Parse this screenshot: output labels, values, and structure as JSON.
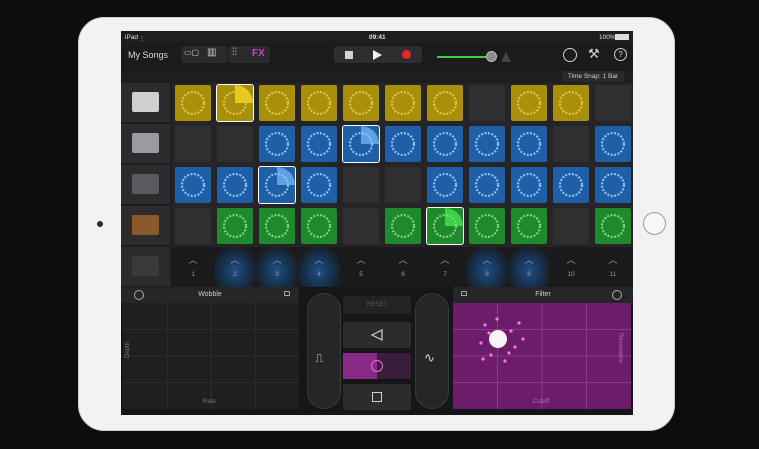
{
  "status": {
    "device": "iPad",
    "time": "09:41",
    "battery": "100%"
  },
  "toolbar": {
    "songs_label": "My Songs",
    "fx_label": "FX"
  },
  "time_snap": "Time Snap: 1 Bar",
  "instruments": [
    {
      "name": "drum-machine",
      "color": "#cfcfcf"
    },
    {
      "name": "turntable",
      "color": "#9a9aa0"
    },
    {
      "name": "synth-keyboard",
      "color": "#5a5a5e"
    },
    {
      "name": "synth-keyboard-wood",
      "color": "#8b5a2b"
    },
    {
      "name": "pencil-graph",
      "color": "#3a3a3c"
    }
  ],
  "grid": [
    [
      "yellow",
      "yellow-active",
      "yellow",
      "yellow",
      "yellow",
      "yellow",
      "yellow",
      "empty",
      "yellow",
      "yellow",
      "empty"
    ],
    [
      "empty",
      "empty",
      "blue",
      "blue",
      "blue-active",
      "blue",
      "blue",
      "blue",
      "blue",
      "empty",
      "blue"
    ],
    [
      "blue",
      "blue",
      "blue-active",
      "blue",
      "empty",
      "empty",
      "blue",
      "blue",
      "blue",
      "blue",
      "blue"
    ],
    [
      "empty",
      "green",
      "green",
      "green",
      "empty",
      "green",
      "green-active",
      "green",
      "green",
      "empty",
      "green"
    ]
  ],
  "triggers": [
    {
      "label": "1",
      "lit": false
    },
    {
      "label": "2",
      "lit": true
    },
    {
      "label": "3",
      "lit": true
    },
    {
      "label": "4",
      "lit": true
    },
    {
      "label": "5",
      "lit": false
    },
    {
      "label": "6",
      "lit": false
    },
    {
      "label": "7",
      "lit": false
    },
    {
      "label": "8",
      "lit": true
    },
    {
      "label": "9",
      "lit": true
    },
    {
      "label": "10",
      "lit": false
    },
    {
      "label": "11",
      "lit": false
    }
  ],
  "fx": {
    "left": {
      "title": "Wobble",
      "x_label": "Rate",
      "y_label": "Depth"
    },
    "right": {
      "title": "Filter",
      "x_label": "Cutoff",
      "y_label": "Resonance"
    },
    "center_top_label": "RESET"
  },
  "colors": {
    "yellow": "#a9900c",
    "blue": "#1e5fa8",
    "green": "#1f8a2b",
    "accent": "#d23cd0",
    "record": "#e02a2a",
    "volume": "#3fce3f"
  }
}
